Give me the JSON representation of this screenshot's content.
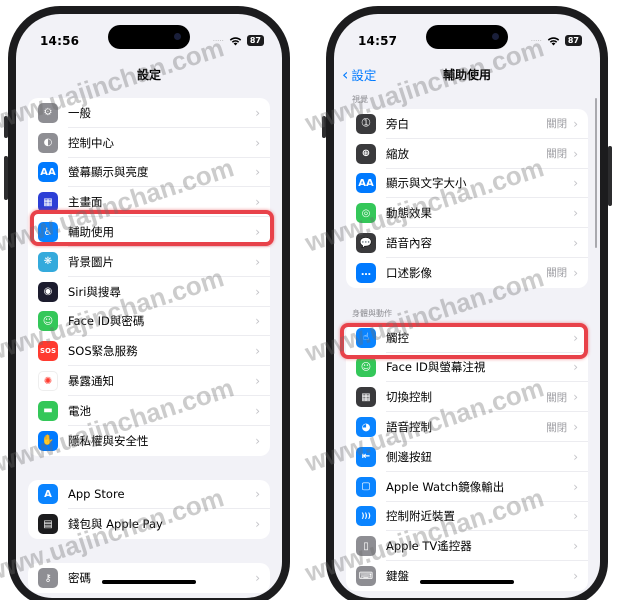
{
  "left_screen": {
    "status": {
      "time": "14:56",
      "battery": "87"
    },
    "nav_title": "設定",
    "groups": [
      [
        {
          "label": "一般",
          "icon": "gear-icon",
          "color": "#8e8e93",
          "glyph": "⚙"
        },
        {
          "label": "控制中心",
          "icon": "toggles-icon",
          "color": "#8e8e93",
          "glyph": "◐"
        },
        {
          "label": "螢幕顯示與亮度",
          "icon": "text-size-icon",
          "color": "#007aff",
          "glyph": "AA"
        },
        {
          "label": "主畫面",
          "icon": "home-grid-icon",
          "color": "#2c3fd6",
          "glyph": "▦"
        },
        {
          "label": "輔助使用",
          "icon": "accessibility-icon",
          "color": "#0a84ff",
          "glyph": "♿"
        },
        {
          "label": "背景圖片",
          "icon": "wallpaper-icon",
          "color": "#34aadc",
          "glyph": "❋"
        },
        {
          "label": "Siri與搜尋",
          "icon": "siri-icon",
          "color": "#1c1c2e",
          "glyph": "◉"
        },
        {
          "label": "Face ID與密碼",
          "icon": "face-id-icon",
          "color": "#34c759",
          "glyph": "☺"
        },
        {
          "label": "SOS緊急服務",
          "icon": "sos-icon",
          "color": "#ff3b30",
          "glyph": "SOS"
        },
        {
          "label": "暴露通知",
          "icon": "exposure-icon",
          "color": "#ffffff",
          "glyph": "✺"
        },
        {
          "label": "電池",
          "icon": "battery-icon",
          "color": "#34c759",
          "glyph": "▬"
        },
        {
          "label": "隱私權與安全性",
          "icon": "hand-icon",
          "color": "#007aff",
          "glyph": "✋"
        }
      ],
      [
        {
          "label": "App Store",
          "icon": "app-store-icon",
          "color": "#0a84ff",
          "glyph": "A"
        },
        {
          "label": "錢包與 Apple Pay",
          "icon": "wallet-icon",
          "color": "#1c1c1e",
          "glyph": "▤"
        }
      ],
      [
        {
          "label": "密碼",
          "icon": "key-icon",
          "color": "#8e8e93",
          "glyph": "⚷"
        }
      ]
    ],
    "highlighted_item": "輔助使用"
  },
  "right_screen": {
    "status": {
      "time": "14:57",
      "battery": "87"
    },
    "back_label": "設定",
    "nav_title": "輔助使用",
    "sections": [
      {
        "header": "視覺",
        "items": [
          {
            "label": "旁白",
            "value": "關閉",
            "icon": "voiceover-icon",
            "color": "#3a3a3c",
            "glyph": "➀"
          },
          {
            "label": "縮放",
            "value": "關閉",
            "icon": "zoom-icon",
            "color": "#3a3a3c",
            "glyph": "⊕"
          },
          {
            "label": "顯示與文字大小",
            "value": "",
            "icon": "text-size-icon",
            "color": "#007aff",
            "glyph": "AA"
          },
          {
            "label": "動態效果",
            "value": "",
            "icon": "motion-icon",
            "color": "#34c759",
            "glyph": "◎"
          },
          {
            "label": "語音內容",
            "value": "",
            "icon": "spoken-content-icon",
            "color": "#3a3a3c",
            "glyph": "💬"
          },
          {
            "label": "口述影像",
            "value": "關閉",
            "icon": "audio-description-icon",
            "color": "#007aff",
            "glyph": "…"
          }
        ]
      },
      {
        "header": "身體與動作",
        "items": [
          {
            "label": "觸控",
            "value": "",
            "icon": "touch-hand-icon",
            "color": "#0a84ff",
            "glyph": "☝"
          },
          {
            "label": "Face ID與螢幕注視",
            "value": "",
            "icon": "face-id-icon",
            "color": "#34c759",
            "glyph": "☺"
          },
          {
            "label": "切換控制",
            "value": "關閉",
            "icon": "switch-control-icon",
            "color": "#3a3a3c",
            "glyph": "▦"
          },
          {
            "label": "語音控制",
            "value": "關閉",
            "icon": "voice-control-icon",
            "color": "#0a84ff",
            "glyph": "◕"
          },
          {
            "label": "側邊按鈕",
            "value": "",
            "icon": "side-button-icon",
            "color": "#0a84ff",
            "glyph": "⇤"
          },
          {
            "label": "Apple Watch鏡像輸出",
            "value": "",
            "icon": "watch-mirroring-icon",
            "color": "#0a84ff",
            "glyph": "▢"
          },
          {
            "label": "控制附近裝置",
            "value": "",
            "icon": "nearby-devices-icon",
            "color": "#0a84ff",
            "glyph": ")))"
          },
          {
            "label": "Apple TV遙控器",
            "value": "",
            "icon": "tv-remote-icon",
            "color": "#8e8e93",
            "glyph": "▯"
          },
          {
            "label": "鍵盤",
            "value": "",
            "icon": "keyboard-icon",
            "color": "#8e8e93",
            "glyph": "⌨"
          }
        ]
      }
    ],
    "highlighted_item": "觸控"
  },
  "watermark": "www.uajinchan.com",
  "highlight_color": "#e8424a"
}
